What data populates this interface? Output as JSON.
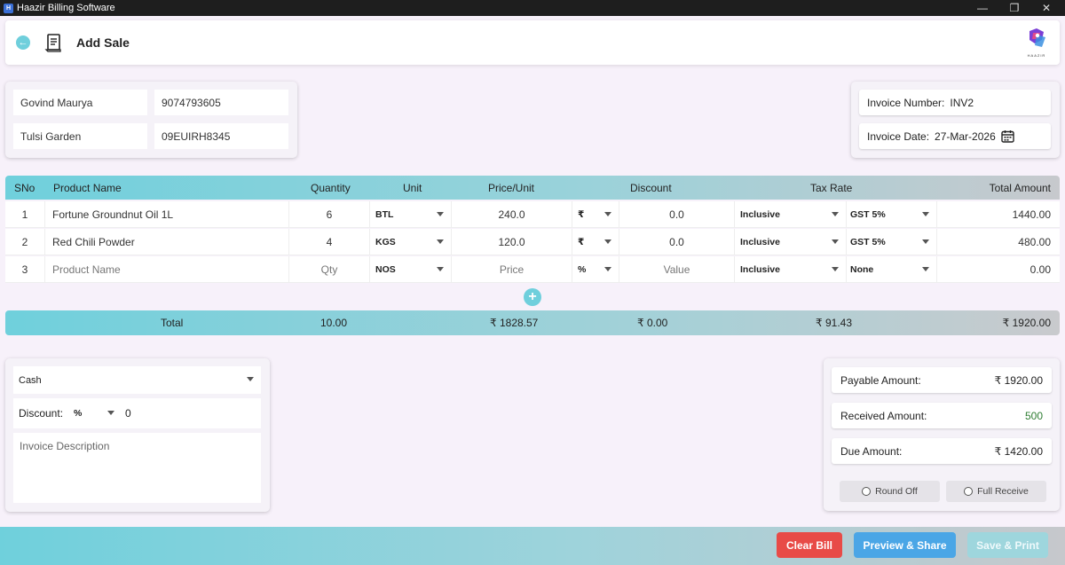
{
  "window": {
    "title": "Haazir Billing Software",
    "minimize": "—",
    "maximize": "❐",
    "close": "✕"
  },
  "header": {
    "title": "Add Sale",
    "logo_text": "HAAZIR"
  },
  "customer": {
    "name": "Govind Maurya",
    "phone": "9074793605",
    "address": "Tulsi Garden",
    "gstin": "09EUIRH8345"
  },
  "invoice": {
    "number_label": "Invoice Number:",
    "number": "INV2",
    "date_label": "Invoice Date:",
    "date": "27-Mar-2026"
  },
  "table": {
    "headers": {
      "sno": "SNo",
      "product": "Product Name",
      "quantity": "Quantity",
      "unit": "Unit",
      "price": "Price/Unit",
      "discount": "Discount",
      "tax": "Tax Rate",
      "total": "Total Amount"
    },
    "rows": [
      {
        "sno": "1",
        "product": "Fortune Groundnut Oil 1L",
        "qty": "6",
        "unit": "BTL",
        "price": "240.0",
        "disc_type": "₹",
        "discount": "0.0",
        "tax_mode": "Inclusive",
        "tax_rate": "GST 5%",
        "amount": "1440.00"
      },
      {
        "sno": "2",
        "product": "Red Chili Powder",
        "qty": "4",
        "unit": "KGS",
        "price": "120.0",
        "disc_type": "₹",
        "discount": "0.0",
        "tax_mode": "Inclusive",
        "tax_rate": "GST 5%",
        "amount": "480.00"
      },
      {
        "sno": "3",
        "product": "Product Name",
        "qty": "Qty",
        "unit": "NOS",
        "price": "Price",
        "disc_type": "%",
        "discount": "Value",
        "tax_mode": "Inclusive",
        "tax_rate": "None",
        "amount": "0.00"
      }
    ],
    "add_row": "+"
  },
  "totals": {
    "label": "Total",
    "quantity": "10.00",
    "price": "₹ 1828.57",
    "discount": "₹ 0.00",
    "tax": "₹ 91.43",
    "amount": "₹ 1920.00"
  },
  "payment": {
    "mode": "Cash",
    "discount_label": "Discount:",
    "discount_type": "%",
    "discount_value": "0",
    "description_placeholder": "Invoice Description"
  },
  "amounts": {
    "payable_label": "Payable Amount:",
    "payable": "₹ 1920.00",
    "received_label": "Received Amount:",
    "received": "500",
    "due_label": "Due Amount:",
    "due": "₹ 1420.00",
    "round_off": "Round Off",
    "full_receive": "Full Receive"
  },
  "footer": {
    "clear": "Clear Bill",
    "preview": "Preview & Share",
    "save": "Save & Print"
  },
  "colors": {
    "accent": "#6fcfdc",
    "clear": "#e84b47",
    "preview": "#4aa6e6",
    "save_disabled": "#9ed6dd"
  }
}
